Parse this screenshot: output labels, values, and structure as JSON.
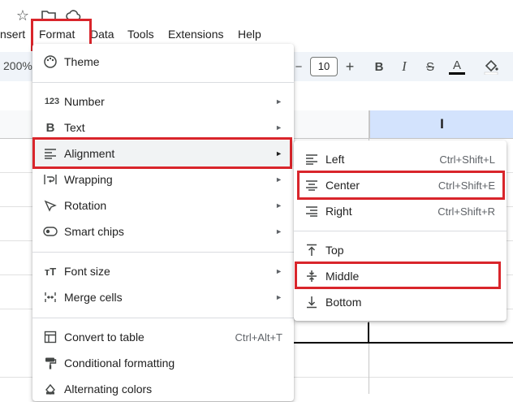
{
  "menubar": {
    "items": [
      "nsert",
      "Format",
      "Data",
      "Tools",
      "Extensions",
      "Help"
    ]
  },
  "toolbar": {
    "zoom": "200%",
    "font_size": "10",
    "minus": "−",
    "plus": "+"
  },
  "sheet": {
    "column_label": "I"
  },
  "format_menu": {
    "items": [
      {
        "label": "Theme"
      },
      {
        "label": "Number"
      },
      {
        "label": "Text"
      },
      {
        "label": "Alignment"
      },
      {
        "label": "Wrapping"
      },
      {
        "label": "Rotation"
      },
      {
        "label": "Smart chips"
      },
      {
        "label": "Font size"
      },
      {
        "label": "Merge cells"
      },
      {
        "label": "Convert to table",
        "shortcut": "Ctrl+Alt+T"
      },
      {
        "label": "Conditional formatting"
      },
      {
        "label": "Alternating colors"
      }
    ]
  },
  "alignment_menu": {
    "items": [
      {
        "label": "Left",
        "shortcut": "Ctrl+Shift+L"
      },
      {
        "label": "Center",
        "shortcut": "Ctrl+Shift+E"
      },
      {
        "label": "Right",
        "shortcut": "Ctrl+Shift+R"
      },
      {
        "label": "Top"
      },
      {
        "label": "Middle"
      },
      {
        "label": "Bottom"
      }
    ]
  },
  "colors": {
    "highlight": "#d9252b",
    "selected_header": "#d3e3fd",
    "toolbar_bg": "#f0f4f9"
  }
}
